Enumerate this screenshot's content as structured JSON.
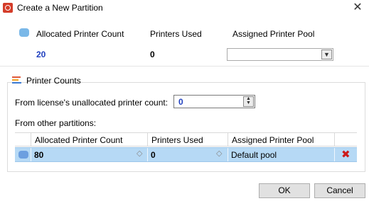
{
  "window": {
    "title": "Create a New Partition",
    "close_glyph": "✕"
  },
  "header": {
    "allocated_label": "Allocated Printer Count",
    "used_label": "Printers Used",
    "pool_label": "Assigned Printer Pool",
    "allocated_value": "20",
    "used_value": "0",
    "pool_value": "",
    "swatch_color": "#7ab8e8"
  },
  "printer_counts": {
    "legend": "Printer Counts",
    "unallocated_label": "From license's unallocated printer count:",
    "unallocated_value": "0",
    "other_partitions_label": "From other partitions:",
    "columns": [
      "Allocated Printer Count",
      "Printers Used",
      "Assigned Printer Pool"
    ],
    "rows": [
      {
        "allocated": "80",
        "used": "0",
        "pool": "Default pool",
        "swatch_color": "#6c9fe0"
      }
    ]
  },
  "buttons": {
    "ok": "OK",
    "cancel": "Cancel"
  },
  "icons": {
    "app": "partition-app-icon",
    "legend": "bar-chart-icon",
    "delete": "delete-x-icon",
    "dropdown": "chevron-down-icon",
    "spinner": "spinner-arrows-icon"
  },
  "colors": {
    "accent_value": "#1f3fbf",
    "selected_row": "#b6d9f5",
    "delete": "#cc1a1a"
  }
}
